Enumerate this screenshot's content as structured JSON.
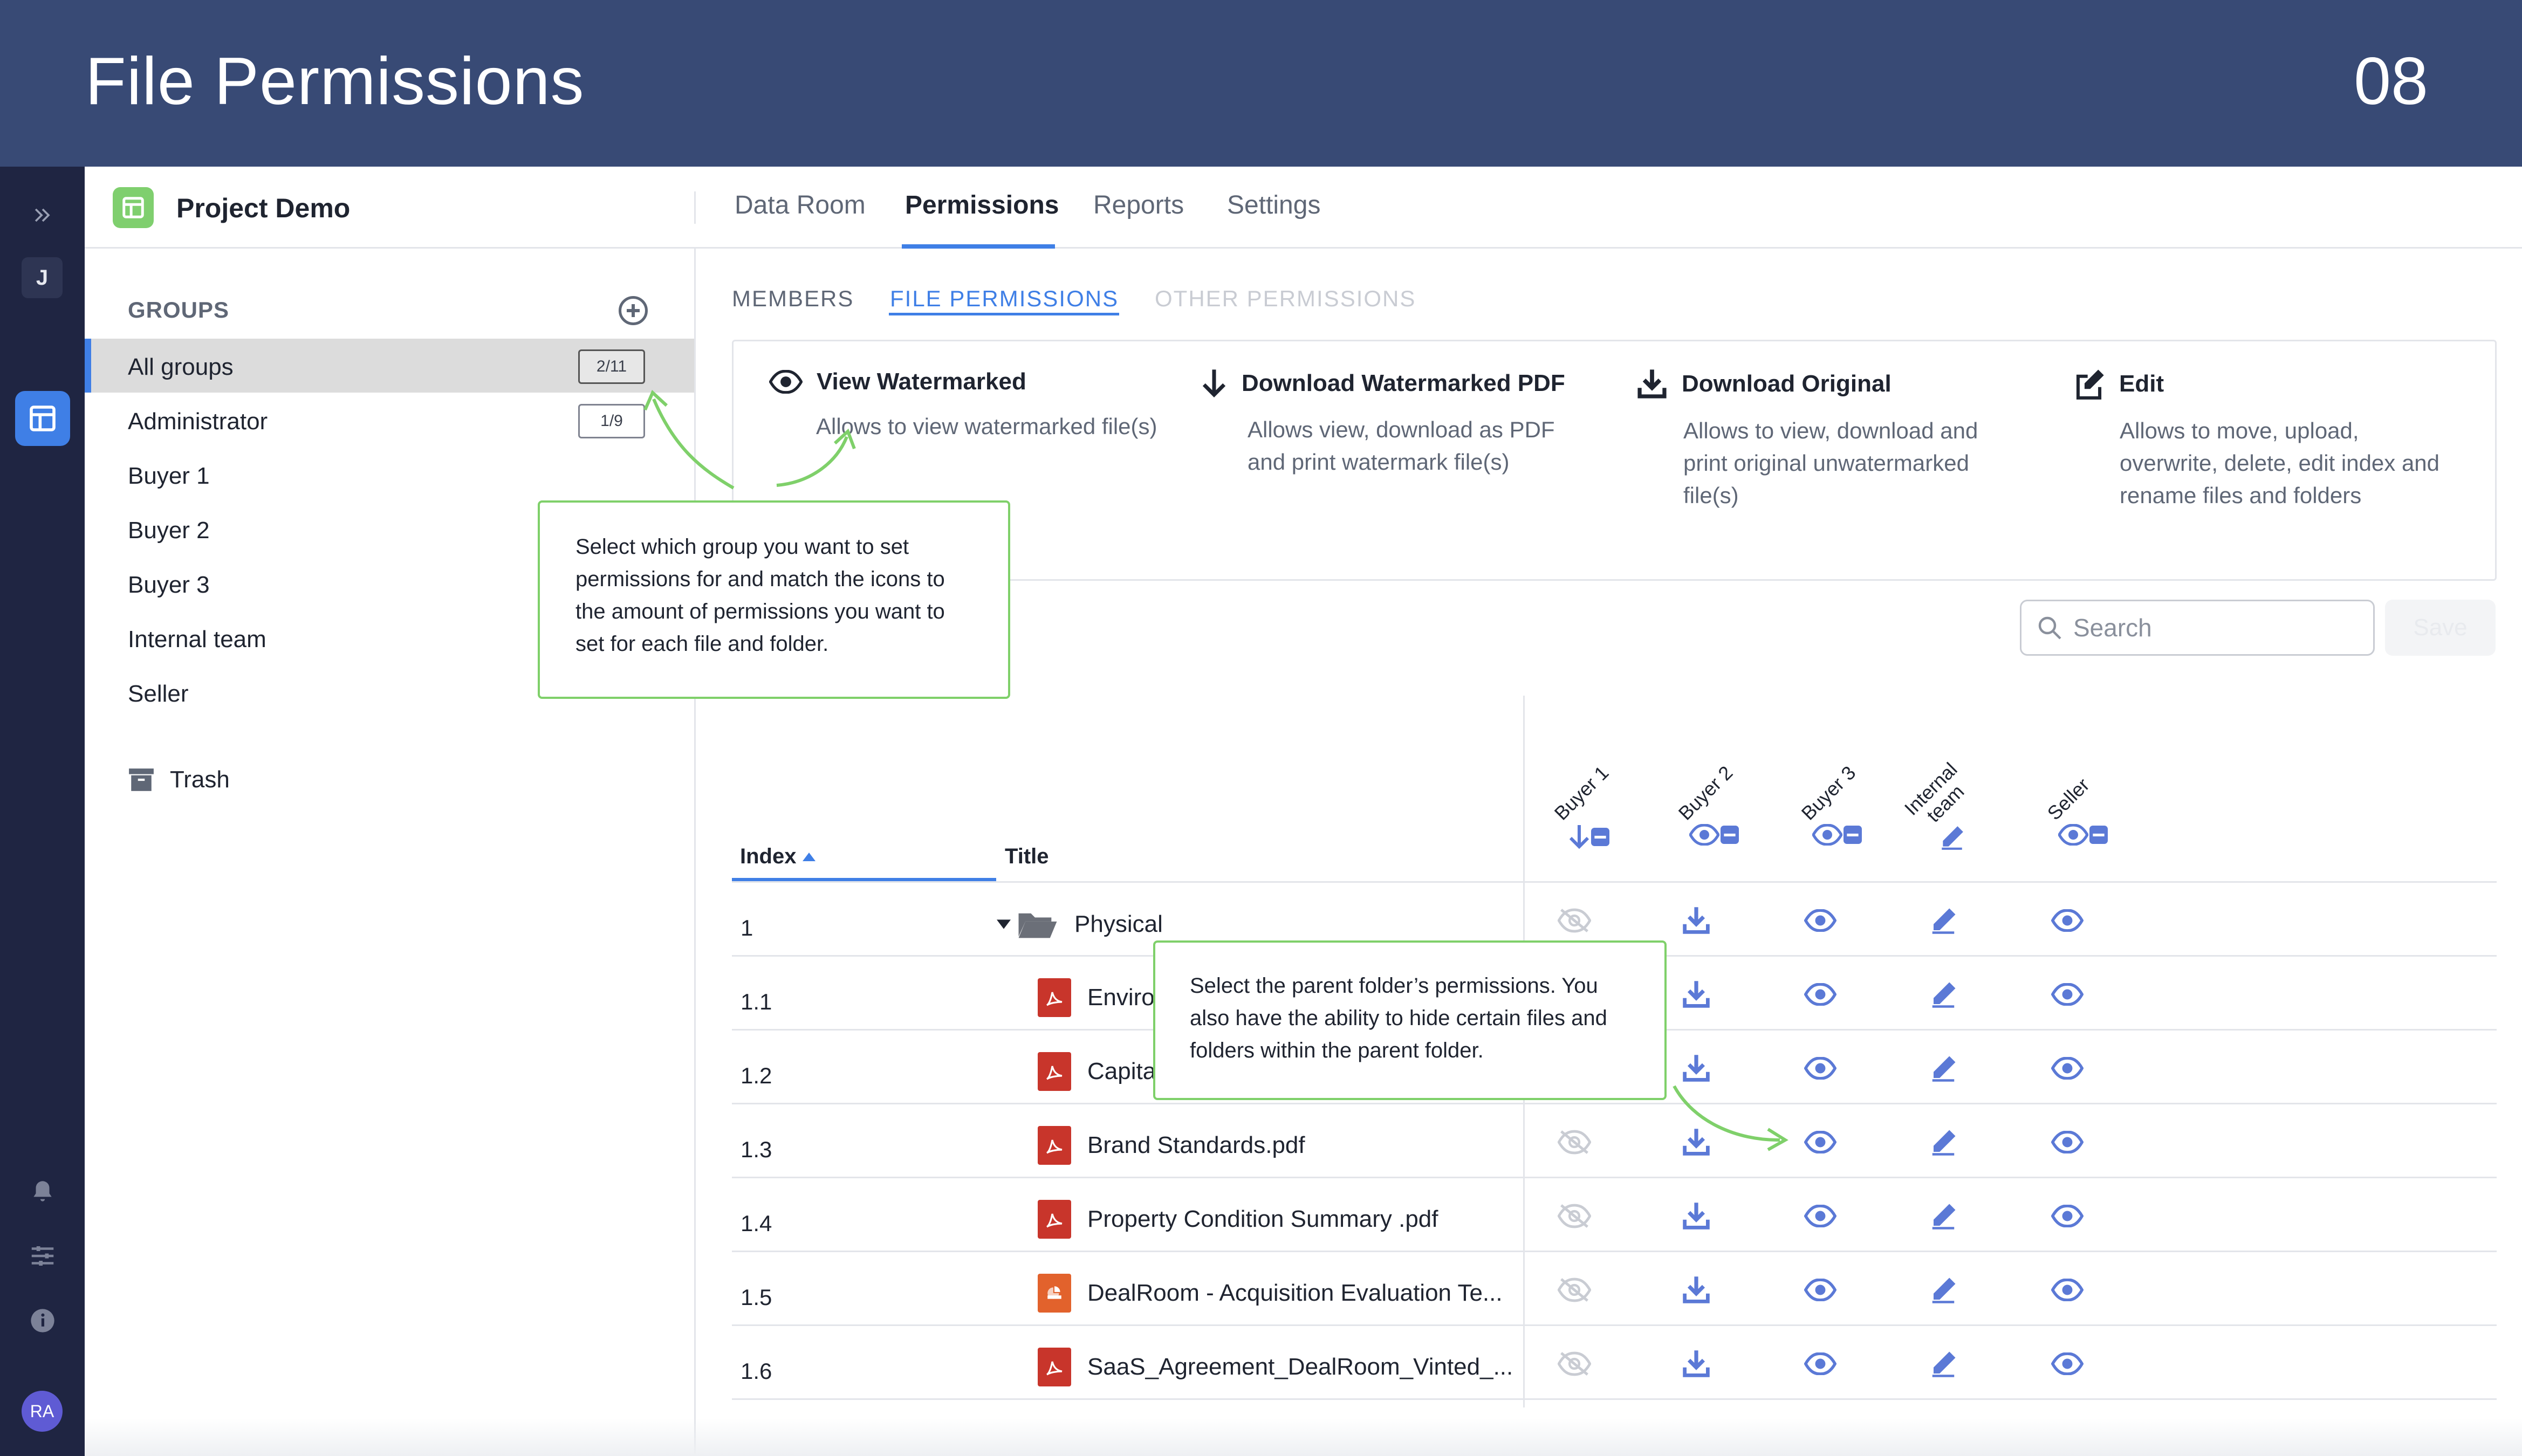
{
  "banner": {
    "title": "File Permissions",
    "page_number": "08"
  },
  "rail": {
    "workspace_initial": "J",
    "user_initials": "RA"
  },
  "header": {
    "project_name": "Project Demo",
    "tabs": [
      {
        "label": "Data Room"
      },
      {
        "label": "Permissions",
        "active": true
      },
      {
        "label": "Reports"
      },
      {
        "label": "Settings"
      }
    ]
  },
  "groups": {
    "heading": "GROUPS",
    "items": [
      {
        "label": "All groups",
        "badge": "2/11",
        "selected": true
      },
      {
        "label": "Administrator",
        "badge": "1/9"
      },
      {
        "label": "Buyer 1",
        "badge": ""
      },
      {
        "label": "Buyer 2",
        "badge": ""
      },
      {
        "label": "Buyer 3",
        "badge": ""
      },
      {
        "label": "Internal team",
        "badge": ""
      },
      {
        "label": "Seller",
        "badge": ""
      }
    ],
    "trash_label": "Trash"
  },
  "subtabs": [
    {
      "label": "MEMBERS"
    },
    {
      "label": "FILE PERMISSIONS",
      "active": true
    },
    {
      "label": "OTHER PERMISSIONS",
      "disabled": true
    }
  ],
  "legend": [
    {
      "title": "View Watermarked",
      "icon": "eye-icon",
      "desc": "Allows to view watermarked file(s)"
    },
    {
      "title": "Download Watermarked PDF",
      "icon": "arrow-down-icon",
      "desc": "Allows view, download as PDF and print watermark file(s)"
    },
    {
      "title": "Download Original",
      "icon": "download-icon",
      "desc": "Allows to view, download and print original unwatermarked file(s)"
    },
    {
      "title": "Edit",
      "icon": "edit-icon",
      "desc": "Allows to move, upload, overwrite, delete, edit index and rename files and folders"
    }
  ],
  "search": {
    "placeholder": "Search",
    "value": ""
  },
  "save_label": "Save",
  "table": {
    "index_header": "Index",
    "title_header": "Title",
    "columns": [
      {
        "label": "Buyer 1",
        "icon": "arrow-down-icon"
      },
      {
        "label": "Buyer 2",
        "icon": "eye-icon"
      },
      {
        "label": "Buyer 3",
        "icon": "eye-icon"
      },
      {
        "label": "Internal\nteam",
        "icon": "edit-icon"
      },
      {
        "label": "Seller",
        "icon": "eye-icon"
      }
    ],
    "rows": [
      {
        "index": "1",
        "title": "Physical",
        "type": "folder",
        "perms": [
          "hidden-icon",
          "download-icon",
          "eye-icon",
          "edit-icon",
          "eye-icon"
        ]
      },
      {
        "index": "1.1",
        "title": "Enviro",
        "type": "pdf",
        "perms": [
          "hidden-icon",
          "download-icon",
          "eye-icon",
          "edit-icon",
          "eye-icon"
        ]
      },
      {
        "index": "1.2",
        "title": "Capita",
        "type": "pdf",
        "perms": [
          "hidden-icon",
          "download-icon",
          "eye-icon",
          "edit-icon",
          "eye-icon"
        ]
      },
      {
        "index": "1.3",
        "title": "Brand Standards.pdf",
        "type": "pdf",
        "perms": [
          "hidden-icon",
          "download-icon",
          "eye-icon",
          "edit-icon",
          "eye-icon"
        ]
      },
      {
        "index": "1.4",
        "title": "Property Condition Summary .pdf",
        "type": "pdf",
        "perms": [
          "hidden-icon",
          "download-icon",
          "eye-icon",
          "edit-icon",
          "eye-icon"
        ]
      },
      {
        "index": "1.5",
        "title": "DealRoom - Acquisition Evaluation Te...",
        "type": "slides",
        "perms": [
          "hidden-icon",
          "download-icon",
          "eye-icon",
          "edit-icon",
          "eye-icon"
        ]
      },
      {
        "index": "1.6",
        "title": "SaaS_Agreement_DealRoom_Vinted_...",
        "type": "pdf",
        "perms": [
          "hidden-icon",
          "download-icon",
          "eye-icon",
          "edit-icon",
          "eye-icon"
        ]
      }
    ]
  },
  "callouts": {
    "groups_tip": "Select which group you want to set permissions for and match the icons to the amount of permissions you want to set for each file and folder.",
    "folder_tip": "Select the parent folder’s permissions. You also have the ability to hide certain files and folders within the parent folder."
  },
  "colors": {
    "banner": "#384a75",
    "rail": "#1f2542",
    "accent": "#3f7fe6",
    "icon": "#5b79d6",
    "callout_border": "#7fd06a",
    "pdf": "#c8352b"
  }
}
